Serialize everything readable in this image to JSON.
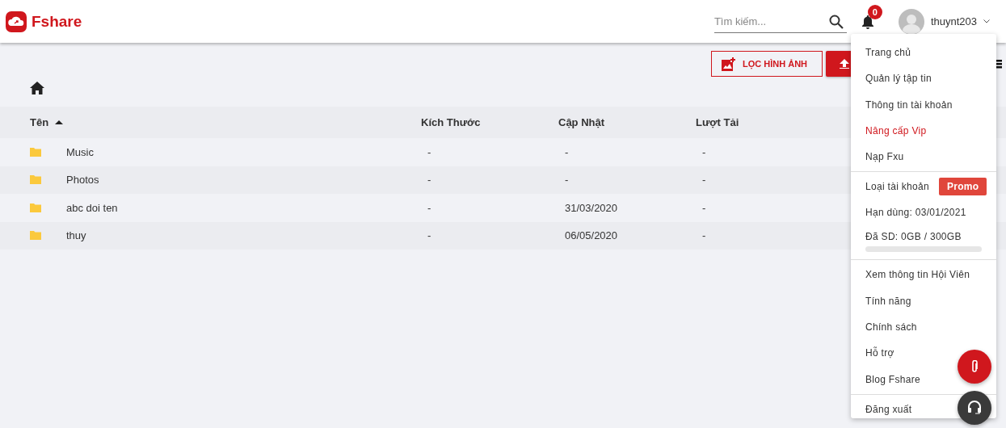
{
  "header": {
    "logo": "Fshare",
    "search": {
      "placeholder": "Tìm kiếm..."
    },
    "notifications": {
      "count": "0"
    },
    "user": {
      "name": "thuynt203"
    }
  },
  "toolbar": {
    "buttons": [
      {
        "kind": "outline",
        "label": "LỌC HÌNH ẢNH"
      },
      {
        "kind": "upload"
      }
    ]
  },
  "table": {
    "columns": [
      {
        "label": "Tên",
        "sorted": true
      },
      {
        "label": "Kích Thước",
        "sorted": false
      },
      {
        "label": "Cập Nhật",
        "sorted": false
      },
      {
        "label": "Lượt Tải",
        "sorted": false
      }
    ],
    "rows": [
      {
        "name": "Music",
        "size": "-",
        "updated": "-",
        "downloads": "-"
      },
      {
        "name": "Photos",
        "size": "-",
        "updated": "-",
        "downloads": "-"
      },
      {
        "name": "abc doi ten",
        "size": "-",
        "updated": "31/03/2020",
        "downloads": "-"
      },
      {
        "name": "thuy",
        "size": "-",
        "updated": "06/05/2020",
        "downloads": "-"
      }
    ]
  },
  "user_menu": {
    "sections": [
      {
        "items": [
          {
            "kind": "link",
            "label": "Trang chủ"
          },
          {
            "kind": "link",
            "label": "Quản lý tập tin"
          },
          {
            "kind": "link",
            "label": "Thông tin tài khoản"
          },
          {
            "kind": "accent",
            "label": "Nâng cấp Vip"
          },
          {
            "kind": "link",
            "label": "Nạp Fxu"
          }
        ]
      },
      {
        "items": [
          {
            "kind": "account-type",
            "label": "Loại tài khoản",
            "badge": "Promo"
          },
          {
            "kind": "info",
            "label": "Hạn dùng: 03/01/2021"
          },
          {
            "kind": "usage",
            "label": "Đã SD: 0GB / 300GB",
            "level": 0
          }
        ]
      },
      {
        "items": [
          {
            "kind": "link",
            "label": "Xem thông tin Hội Viên"
          },
          {
            "kind": "link",
            "label": "Tính năng"
          },
          {
            "kind": "link",
            "label": "Chính sách"
          },
          {
            "kind": "link",
            "label": "Hỗ trợ"
          },
          {
            "kind": "link",
            "label": "Blog Fshare"
          }
        ]
      },
      {
        "items": [
          {
            "kind": "link",
            "label": "Đăng xuất"
          }
        ]
      }
    ]
  },
  "fabs": [
    {
      "kind": "attach"
    },
    {
      "kind": "support"
    }
  ]
}
